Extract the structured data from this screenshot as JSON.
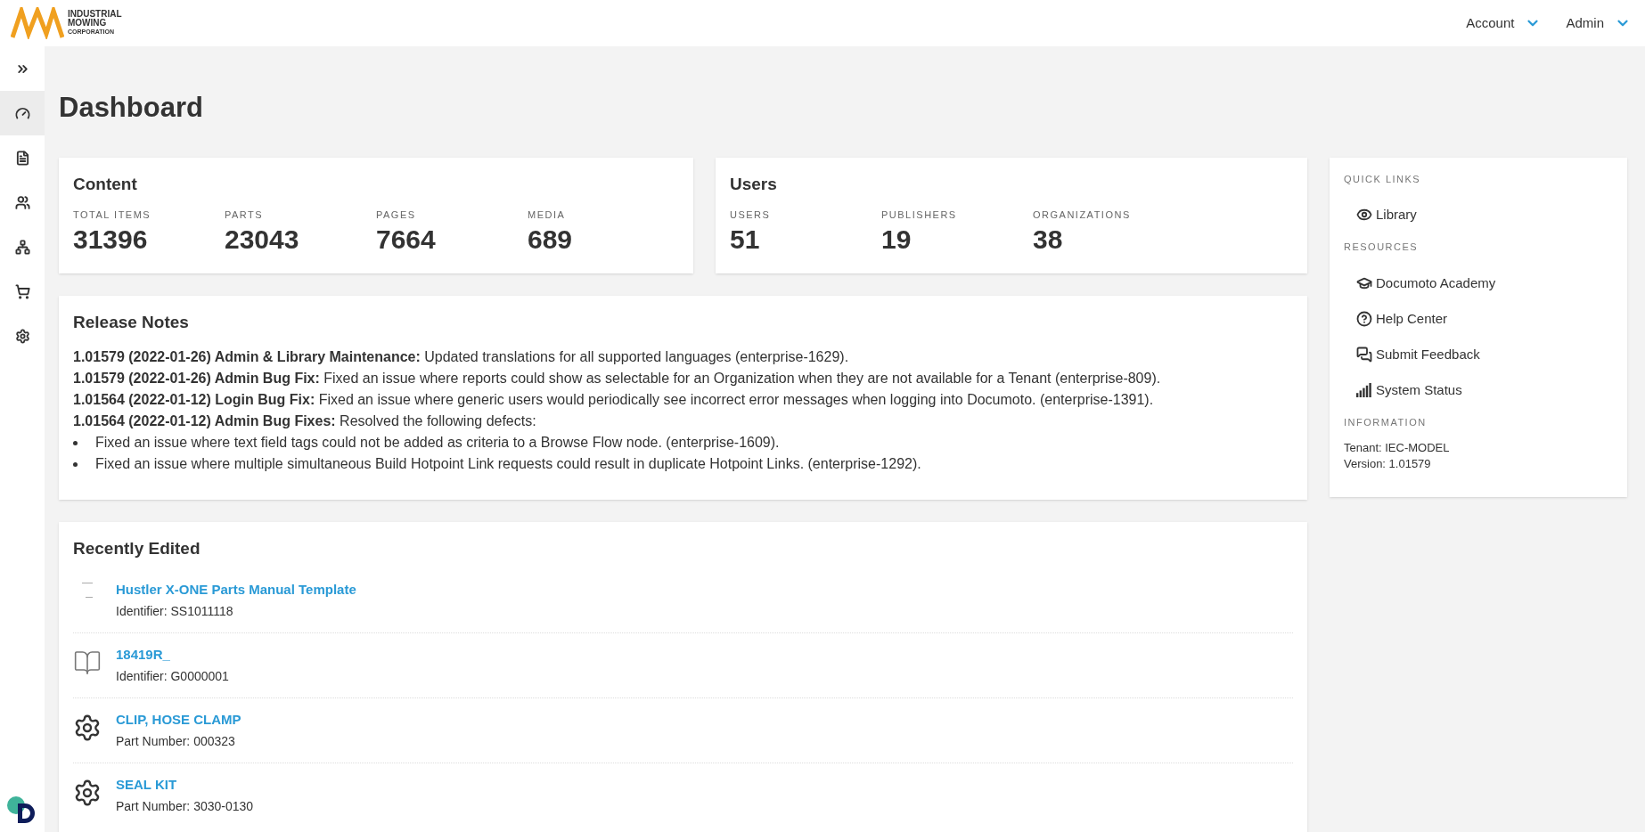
{
  "header": {
    "logo_lines": [
      "INDUSTRIAL",
      "MOWING",
      "CORPORATION"
    ],
    "menus": [
      {
        "label": "Account"
      },
      {
        "label": "Admin"
      }
    ]
  },
  "sidebar": {
    "items": [
      {
        "kind": "expand",
        "selected": false
      },
      {
        "kind": "dashboard",
        "selected": true
      },
      {
        "kind": "content",
        "selected": false
      },
      {
        "kind": "users",
        "selected": false
      },
      {
        "kind": "organizations",
        "selected": false
      },
      {
        "kind": "cart",
        "selected": false
      },
      {
        "kind": "settings",
        "selected": false
      }
    ]
  },
  "page_title": "Dashboard",
  "stat_cards": [
    {
      "title": "Content",
      "stats": [
        {
          "label": "TOTAL ITEMS",
          "value": "31396"
        },
        {
          "label": "PARTS",
          "value": "23043"
        },
        {
          "label": "PAGES",
          "value": "7664"
        },
        {
          "label": "MEDIA",
          "value": "689"
        }
      ]
    },
    {
      "title": "Users",
      "stats": [
        {
          "label": "USERS",
          "value": "51"
        },
        {
          "label": "PUBLISHERS",
          "value": "19"
        },
        {
          "label": "ORGANIZATIONS",
          "value": "38"
        }
      ]
    }
  ],
  "release_notes": {
    "title": "Release Notes",
    "entries": [
      {
        "kind": "line",
        "text": "**1.01579 (2022-01-26) Admin & Library Maintenance:** Updated translations for all supported languages (enterprise-1629)."
      },
      {
        "kind": "line",
        "text": "**1.01579 (2022-01-26) Admin Bug Fix:** Fixed an issue where reports could show as selectable for an Organization when they are not available for a Tenant (enterprise-809)."
      },
      {
        "kind": "line",
        "text": "**1.01564 (2022-01-12) Login Bug Fix:** Fixed an issue where generic users would periodically see incorrect error messages when logging into Documoto. (enterprise-1391)."
      },
      {
        "kind": "line",
        "text": "**1.01564 (2022-01-12) Admin Bug Fixes:** Resolved the following defects:"
      },
      {
        "kind": "bullet",
        "text": "Fixed an issue where text field tags could not be added as criteria to a Browse Flow node. (enterprise-1609)."
      },
      {
        "kind": "bullet",
        "text": "Fixed an issue where multiple simultaneous Build Hotpoint Link requests could result in duplicate Hotpoint Links. (enterprise-1292)."
      }
    ]
  },
  "recently_edited": {
    "title": "Recently Edited",
    "items": [
      {
        "kind": "template",
        "name": "Hustler X-ONE Parts Manual Template",
        "detail": "Identifier: SS1011118"
      },
      {
        "kind": "book",
        "name": "18419R_",
        "detail": "Identifier: G0000001"
      },
      {
        "kind": "part",
        "name": "CLIP, HOSE CLAMP",
        "detail": "Part Number: 000323"
      },
      {
        "kind": "part",
        "name": "SEAL KIT",
        "detail": "Part Number: 3030-0130"
      }
    ]
  },
  "side_panel": {
    "sections": [
      {
        "heading": "QUICK LINKS",
        "links": [
          {
            "kind": "eye",
            "label": "Library"
          }
        ]
      },
      {
        "heading": "RESOURCES",
        "links": [
          {
            "kind": "cap",
            "label": "Documoto Academy"
          },
          {
            "kind": "help",
            "label": "Help Center"
          },
          {
            "kind": "chat",
            "label": "Submit Feedback"
          },
          {
            "kind": "signal",
            "label": "System Status"
          }
        ]
      },
      {
        "heading": "INFORMATION",
        "lines": [
          "Tenant: IEC-MODEL",
          "Version: 1.01579"
        ]
      }
    ]
  }
}
